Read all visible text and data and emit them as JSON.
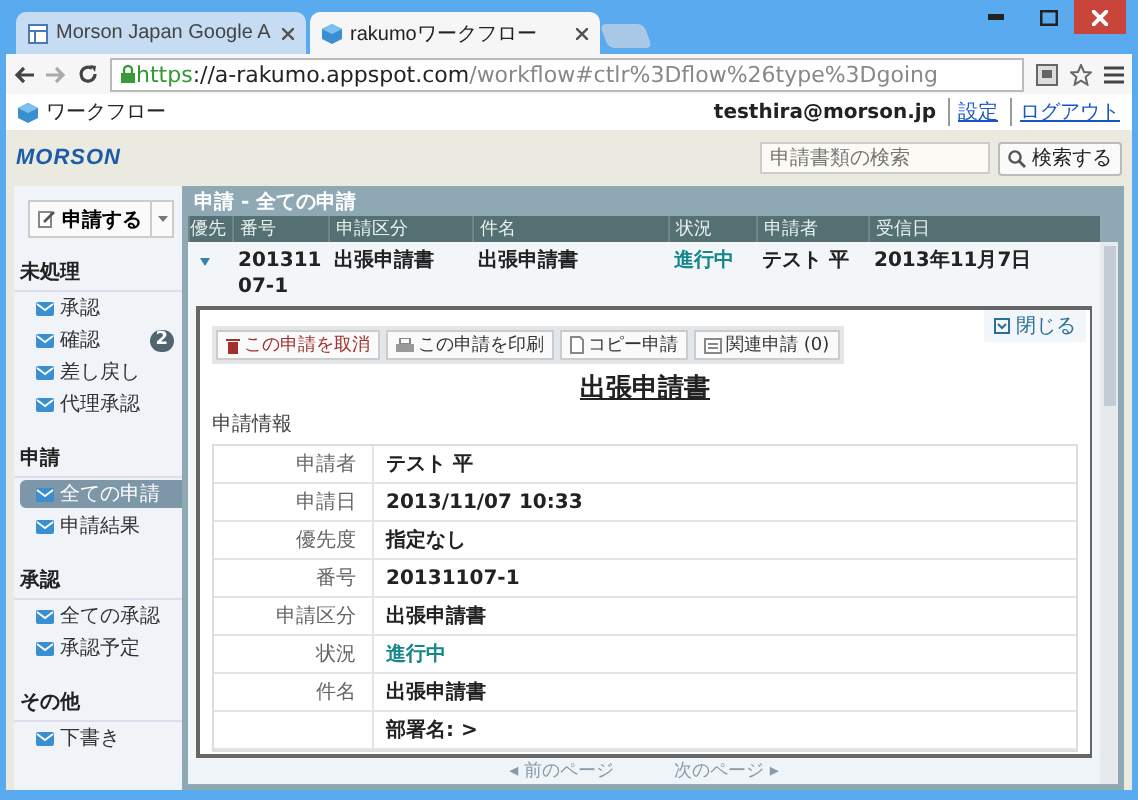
{
  "browser": {
    "tabs": [
      {
        "label": "Morson Japan Google A",
        "selected": false
      },
      {
        "label": "rakumoワークフロー",
        "selected": true
      }
    ],
    "url": {
      "scheme": "https",
      "host": "://a-rakumo.appspot.com",
      "path": "/workflow#ctlr%3Dflow%26type%3Dgoing"
    }
  },
  "header": {
    "app_title": "ワークフロー",
    "user": "testhira@morson.jp",
    "links": [
      "設定",
      "ログアウト"
    ]
  },
  "band": {
    "logo": "MORSON",
    "search": {
      "placeholder": "申請書類の検索"
    },
    "search_button": "検索する"
  },
  "sidebar": {
    "new_button": "申請する",
    "sections": [
      {
        "title": "未処理",
        "items": [
          {
            "label": "承認",
            "selected": false
          },
          {
            "label": "確認",
            "selected": false,
            "badge": "2"
          },
          {
            "label": "差し戻し",
            "selected": false
          },
          {
            "label": "代理承認",
            "selected": false
          }
        ]
      },
      {
        "title": "申請",
        "items": [
          {
            "label": "全ての申請",
            "selected": true
          },
          {
            "label": "申請結果",
            "selected": false
          }
        ]
      },
      {
        "title": "承認",
        "items": [
          {
            "label": "全ての承認",
            "selected": false
          },
          {
            "label": "承認予定",
            "selected": false
          }
        ]
      },
      {
        "title": "その他",
        "items": [
          {
            "label": "下書き",
            "selected": false
          }
        ]
      }
    ]
  },
  "list": {
    "title": "申請 - 全ての申請",
    "columns": [
      "優先",
      "番号",
      "申請区分",
      "件名",
      "状況",
      "申請者",
      "受信日"
    ],
    "rows": [
      {
        "expanded": true,
        "cells": [
          null,
          "20131107-1",
          "出張申請書",
          "出張申請書",
          "進行中",
          "テスト 平",
          "2013年11月7日"
        ]
      }
    ]
  },
  "detail": {
    "close": "閉じる",
    "actions": [
      {
        "kind": "cancel",
        "label": "この申請を取消"
      },
      {
        "kind": "print",
        "label": "この申請を印刷"
      },
      {
        "kind": "copy",
        "label": "コピー申請"
      },
      {
        "kind": "related",
        "label": "関連申請 (0)"
      }
    ],
    "heading": "出張申請書",
    "section": "申請情報",
    "fields": [
      {
        "label": "申請者",
        "value": "テスト 平",
        "kind": "text"
      },
      {
        "label": "申請日",
        "value": "2013/11/07 10:33",
        "kind": "text"
      },
      {
        "label": "優先度",
        "value": "指定なし",
        "kind": "text"
      },
      {
        "label": "番号",
        "value": "20131107-1",
        "kind": "text"
      },
      {
        "label": "申請区分",
        "value": "出張申請書",
        "kind": "text"
      },
      {
        "label": "状況",
        "value": "進行中",
        "kind": "status"
      },
      {
        "label": "件名",
        "value": "出張申請書",
        "kind": "text"
      },
      {
        "value": "部署名: >",
        "kind": "text"
      }
    ]
  },
  "pager": {
    "prev": "◂ 前のページ",
    "next": "次のページ ▸",
    "disabled": true
  }
}
